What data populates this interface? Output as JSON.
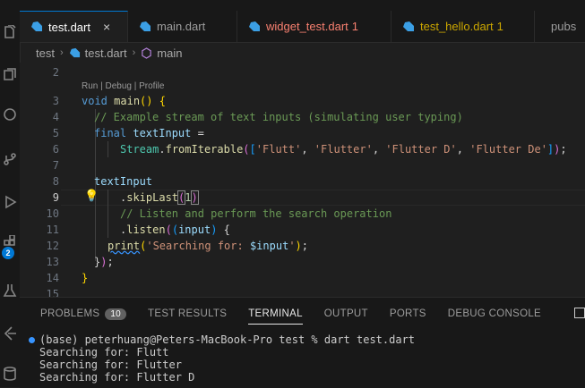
{
  "tabs": [
    {
      "label": "test.dart",
      "close": "×",
      "state": "active"
    },
    {
      "label": "main.dart",
      "state": "normal"
    },
    {
      "label": "widget_test.dart",
      "count": "1",
      "state": "error"
    },
    {
      "label": "test_hello.dart",
      "count": "1",
      "state": "warn"
    },
    {
      "label": "pubs",
      "state": "normal"
    }
  ],
  "breadcrumb": {
    "folder": "test",
    "file": "test.dart",
    "symbol": "main"
  },
  "editor": {
    "codelens": "Run | Debug | Profile",
    "line_numbers": [
      "2",
      "3",
      "4",
      "5",
      "6",
      "7",
      "8",
      "9",
      "10",
      "11",
      "12",
      "13",
      "14",
      "15"
    ],
    "current_line": "9",
    "code": {
      "l3_void": "void",
      "l3_main": "main",
      "l3_paren": "()",
      "l3_brace": "{",
      "l4_comment": "// Example stream of text inputs (simulating user typing)",
      "l5_final": "final",
      "l5_var": "textInput",
      "l5_eq": " =",
      "l6_stream": "Stream",
      "l6_dot": ".",
      "l6_fn": "fromIterable",
      "l6_p1": "(",
      "l6_b1": "[",
      "l6_s1": "'Flutt'",
      "l6_s2": "'Flutter'",
      "l6_s3": "'Flutter D'",
      "l6_s4": "'Flutter De'",
      "l6_comma": ", ",
      "l6_b2": "]",
      "l6_p2": ")",
      "l6_semi": ";",
      "l8_var": "textInput",
      "l9_dot": ".",
      "l9_fn": "skipLast",
      "l9_p1": "(",
      "l9_num": "1",
      "l9_p2": ")",
      "l10_comment": "// Listen and perform the search operation",
      "l11_dot": ".",
      "l11_fn": "listen",
      "l11_p1": "(",
      "l11_p2": "(",
      "l11_param": "input",
      "l11_p3": ")",
      "l11_brace": " {",
      "l12_fn": "print",
      "l12_p1": "(",
      "l12_str1": "'Searching for: ",
      "l12_interp": "$input",
      "l12_str2": "'",
      "l12_p2": ")",
      "l12_semi": ";",
      "l13_brace": "}",
      "l13_p": ")",
      "l13_semi": ";",
      "l14_brace": "}"
    },
    "bulb": "💡"
  },
  "panel": {
    "tabs": [
      {
        "label": "PROBLEMS",
        "count": "10"
      },
      {
        "label": "TEST RESULTS"
      },
      {
        "label": "TERMINAL",
        "active": true
      },
      {
        "label": "OUTPUT"
      },
      {
        "label": "PORTS"
      },
      {
        "label": "DEBUG CONSOLE"
      }
    ],
    "terminal_lines": [
      "(base) peterhuang@Peters-MacBook-Pro test % dart test.dart",
      "Searching for: Flutt",
      "Searching for: Flutter",
      "Searching for: Flutter D"
    ]
  },
  "activity_badge": "2",
  "colors": {
    "accent": "#0078d4",
    "error": "#f88070",
    "warning": "#cca700"
  }
}
